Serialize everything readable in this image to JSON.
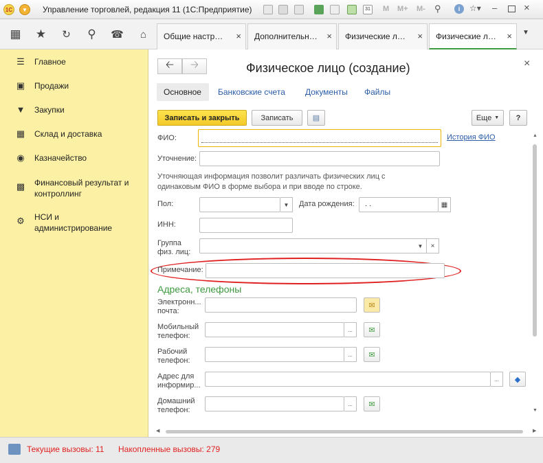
{
  "titlebar": {
    "app_title": "Управление торговлей, редакция 11",
    "platform": "(1С:Предприятие)",
    "logo_text": "1С",
    "m_labels": [
      "M",
      "M+",
      "M-"
    ]
  },
  "tabs": [
    {
      "label": "Общие настр…",
      "close": "×"
    },
    {
      "label": "Дополнительн…",
      "close": "×"
    },
    {
      "label": "Физические л…",
      "close": "×"
    },
    {
      "label": "Физические л…",
      "close": "×"
    }
  ],
  "sidebar": {
    "items": [
      {
        "label": "Главное",
        "icon": "menu-icon"
      },
      {
        "label": "Продажи",
        "icon": "briefcase-icon"
      },
      {
        "label": "Закупки",
        "icon": "cart-icon"
      },
      {
        "label": "Склад и доставка",
        "icon": "warehouse-icon"
      },
      {
        "label": "Казначейство",
        "icon": "coin-icon"
      },
      {
        "label": "Финансовый результат и контроллинг",
        "icon": "chart-icon"
      },
      {
        "label": "НСИ и администрирование",
        "icon": "gear-icon"
      }
    ]
  },
  "form": {
    "title": "Физическое лицо (создание)",
    "close": "×",
    "links": {
      "main": "Основное",
      "bank": "Банковские счета",
      "docs": "Документы",
      "files": "Файлы"
    },
    "buttons": {
      "save_close": "Записать и закрыть",
      "save": "Записать",
      "more": "Еще",
      "help": "?"
    },
    "fields": {
      "fio_label": "ФИО:",
      "fio_value": "",
      "fio_history": "История ФИО",
      "clarify_label": "Уточнение:",
      "clarify_value": "",
      "hint": "Уточняющая информация позволит различать физических лиц  с одинаковым ФИО в форме выбора и при вводе по строке.",
      "gender_label": "Пол:",
      "gender_value": "",
      "birth_label": "Дата рождения:",
      "birth_value": " .  .",
      "inn_label": "ИНН:",
      "inn_value": "",
      "group_label": "Группа физ. лиц:",
      "group_value": "",
      "note_label": "Примечание:",
      "note_value": ""
    },
    "contacts": {
      "section_title": "Адреса, телефоны",
      "email_label": "Электронн... почта:",
      "mobile_label": "Мобильный телефон:",
      "work_label": "Рабочий телефон:",
      "address_label": "Адрес для информир...",
      "home_label": "Домашний телефон:",
      "ellipsis": "..."
    }
  },
  "status": {
    "current_calls": "Текущие вызовы: 11",
    "accum_calls": "Накопленные вызовы: 279"
  },
  "colors": {
    "sidebar_bg": "#fbf0a4",
    "accent_green": "#3e9a3e",
    "link_blue": "#2a5ca8",
    "status_red": "#e02020",
    "highlight_red": "#e02020",
    "focus_yellow": "#f0b400"
  }
}
